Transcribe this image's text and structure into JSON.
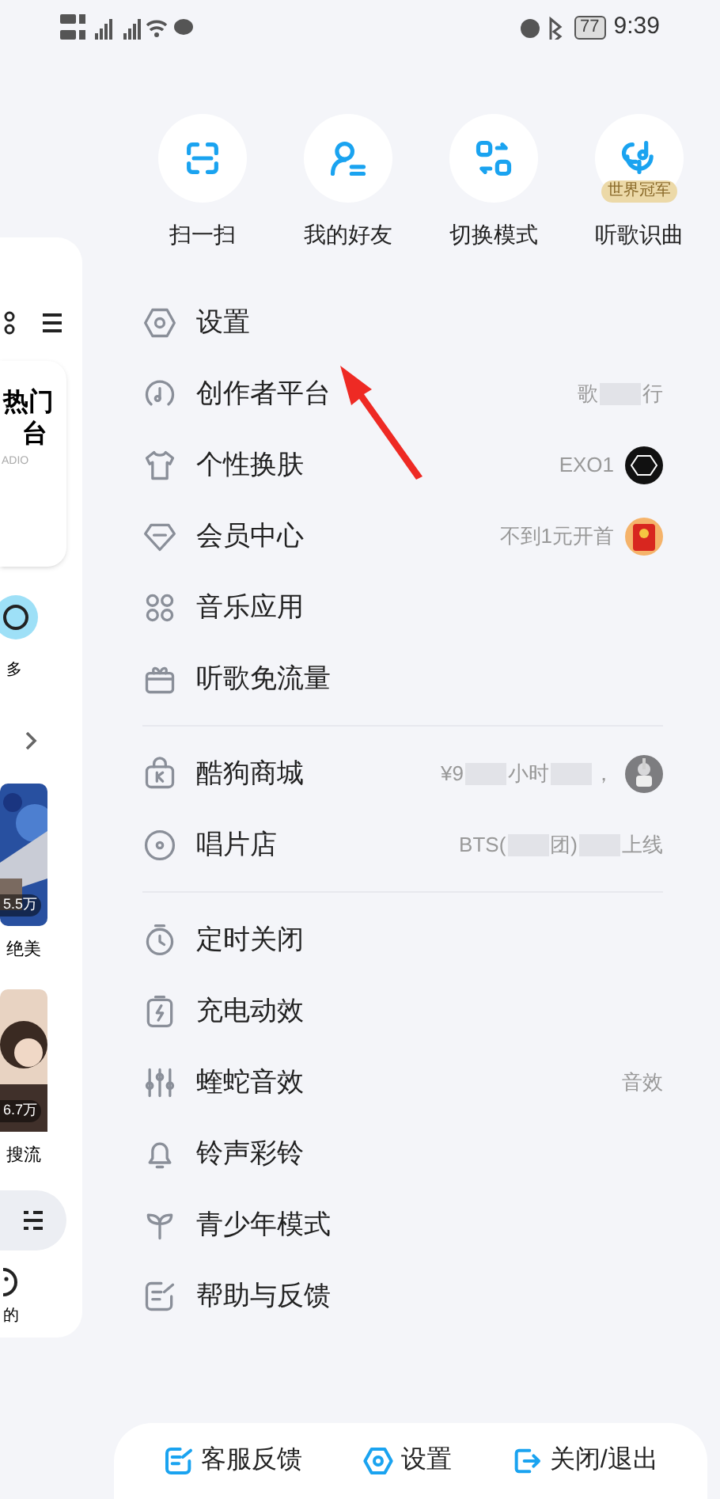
{
  "status_bar": {
    "time": "9:39",
    "battery": "77"
  },
  "side_panel": {
    "radio_title": "热门",
    "radio_subtitle": "台",
    "radio_tag": "ADIO",
    "more": "多",
    "cards": [
      {
        "count": "5.5万",
        "caption": "绝美"
      },
      {
        "count": "6.7万",
        "caption": "搜流"
      }
    ],
    "mine": "的"
  },
  "quick_actions": [
    {
      "label": "扫一扫"
    },
    {
      "label": "我的好友"
    },
    {
      "label": "切换模式"
    },
    {
      "label": "听歌识曲",
      "badge": "世界冠军"
    }
  ],
  "menu_groups": [
    [
      {
        "label": "设置"
      },
      {
        "label": "创作者平台",
        "value": [
          "歌",
          "行"
        ]
      },
      {
        "label": "个性换肤",
        "value": [
          "EXO1"
        ]
      },
      {
        "label": "会员中心",
        "value": [
          "不到1元开首"
        ]
      },
      {
        "label": "音乐应用"
      },
      {
        "label": "听歌免流量"
      }
    ],
    [
      {
        "label": "酷狗商城",
        "value": [
          "¥9",
          "小时",
          "，"
        ]
      },
      {
        "label": "唱片店",
        "value": [
          "BTS(",
          "团)",
          "上线"
        ]
      }
    ],
    [
      {
        "label": "定时关闭"
      },
      {
        "label": "充电动效"
      },
      {
        "label": "蝰蛇音效",
        "value": [
          "音效"
        ]
      },
      {
        "label": "铃声彩铃"
      },
      {
        "label": "青少年模式"
      },
      {
        "label": "帮助与反馈"
      }
    ]
  ],
  "bottom_bar": [
    {
      "label": "客服反馈"
    },
    {
      "label": "设置"
    },
    {
      "label": "关闭/退出"
    }
  ]
}
